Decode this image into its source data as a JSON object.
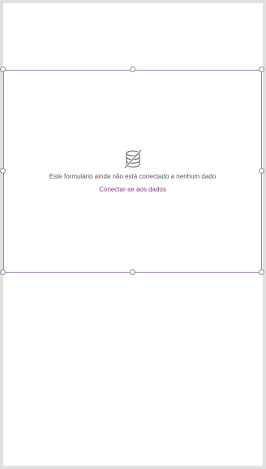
{
  "form": {
    "empty_message": "Este formulário ainda não está conectado a nenhum dado",
    "connect_link": "Conectar-se aos dados",
    "icon": "database-disconnected-icon"
  },
  "colors": {
    "selection_border": "#a57bb6",
    "link": "#8a3c8a",
    "canvas_background": "#ffffff",
    "app_background": "#e1e1e1"
  }
}
